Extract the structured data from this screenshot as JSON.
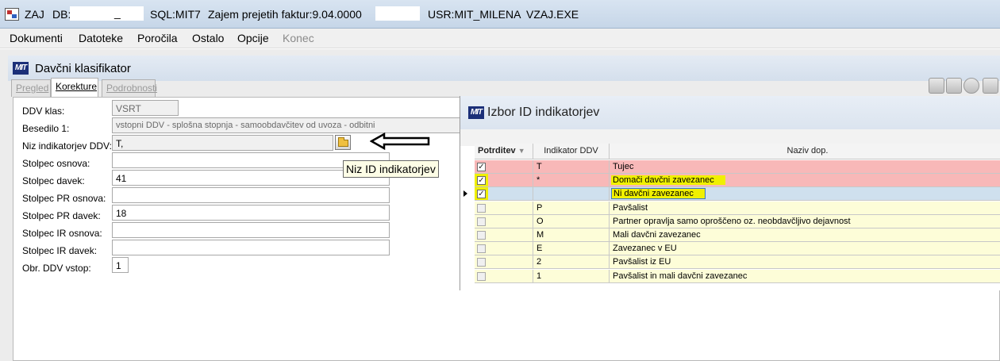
{
  "titlebar": {
    "app": "ZAJ",
    "db_label": "DB:",
    "db_suffix": "_",
    "sql": "SQL:MIT7",
    "module": "Zajem prejetih faktur:9.04.0000",
    "user": "USR:MIT_MILENA",
    "exe": "VZAJ.EXE"
  },
  "menu": [
    "Dokumenti",
    "Datoteke",
    "Poročila",
    "Ostalo",
    "Opcije",
    "Konec"
  ],
  "child_window": {
    "logo": "MIT",
    "title": "Davčni klasifikator",
    "tabs": [
      "Pregled",
      "Korekture",
      "Podrobnosti"
    ],
    "active_tab": "Korekture"
  },
  "form": {
    "ddv_klas": {
      "label": "DDV klas:",
      "value": "VSRT"
    },
    "besedilo1": {
      "label": "Besedilo 1:",
      "value": "vstopni DDV - splošna stopnja - samoobdavčitev od uvoza - odbitni"
    },
    "niz_ind": {
      "label": "Niz indikatorjev DDV:",
      "value": "T,"
    },
    "stolpec_osnova": {
      "label": "Stolpec osnova:",
      "value": ""
    },
    "stolpec_davek": {
      "label": "Stolpec davek:",
      "value": "41"
    },
    "stolpec_pr_osnova": {
      "label": "Stolpec PR osnova:",
      "value": ""
    },
    "stolpec_pr_davek": {
      "label": "Stolpec PR davek:",
      "value": "18"
    },
    "stolpec_ir_osnova": {
      "label": "Stolpec IR osnova:",
      "value": ""
    },
    "stolpec_ir_davek": {
      "label": "Stolpec IR davek:",
      "value": ""
    },
    "obr_ddv_vstop": {
      "label": "Obr. DDV vstop:",
      "value": "1"
    }
  },
  "tooltip": "Niz ID indikatorjev",
  "popup": {
    "title": "Izbor ID indikatorjev",
    "columns": [
      "Potrditev",
      "Indikator DDV",
      "Naziv dop."
    ],
    "rows": [
      {
        "checked": true,
        "code": "T",
        "name": "Tujec"
      },
      {
        "checked": true,
        "code": "*",
        "name": "Domači davčni zavezanec"
      },
      {
        "checked": true,
        "code": "",
        "name": "Ni davčni zavezanec"
      },
      {
        "checked": false,
        "code": "P",
        "name": "Pavšalist"
      },
      {
        "checked": false,
        "code": "O",
        "name": "Partner opravlja samo oproščeno oz. neobdavčljivo dejavnost"
      },
      {
        "checked": false,
        "code": "M",
        "name": "Mali davčni zavezanec"
      },
      {
        "checked": false,
        "code": "E",
        "name": "Zavezanec v EU"
      },
      {
        "checked": false,
        "code": "2",
        "name": "Pavšalist iz EU"
      },
      {
        "checked": false,
        "code": "1",
        "name": "Pavšalist in mali davčni zavezanec"
      }
    ]
  },
  "colors": {
    "selected_row": "#f8b8b8",
    "current_row": "#cfe0ee",
    "yellow_row": "#fdfdd8",
    "highlighter": "#f0f000"
  }
}
